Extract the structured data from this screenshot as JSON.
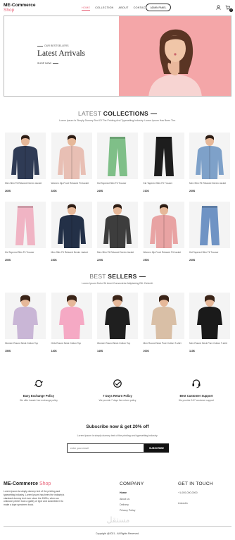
{
  "header": {
    "logo_line1": "ME-Commerce",
    "logo_line2": "Shop",
    "nav": [
      "HOME",
      "COLLECTION",
      "ABOUT",
      "CONTACT"
    ],
    "admin_label": "ADMIN PANEL",
    "icons": [
      "user-icon",
      "cart-icon"
    ],
    "cart_count": "0"
  },
  "hero": {
    "kicker": "OUR BESTSELLERS",
    "title": "Latest Arrivals",
    "cta": "SHOP NOW",
    "bg_color": "#f4a6a8"
  },
  "collections": {
    "title_a": "LATEST",
    "title_b": "COLLECTIONS",
    "subtitle": "Lorem Ipsum Is Simply Dummy Text Of The Printing And Typesetting Industry. Lorem Ipsum Has Been The.",
    "products": [
      {
        "name": "Men Slim Fit Relaxed Denim Jacket",
        "price": "260$",
        "kind": "jacket",
        "color": "#2f3b55"
      },
      {
        "name": "Women Zip-Front Relaxed Fit Jacket",
        "price": "320$",
        "kind": "jacket",
        "color": "#e8bfb4"
      },
      {
        "name": "Kid Tapered Slim Fit Trouser",
        "price": "240$",
        "kind": "pants",
        "color": "#7fbf88"
      },
      {
        "name": "Kid Tapered Slim Fit Trouser",
        "price": "210$",
        "kind": "pants",
        "color": "#1d1d1d"
      },
      {
        "name": "Men Slim Fit Relaxed Denim Jacket",
        "price": "260$",
        "kind": "jacket",
        "color": "#7ea1c9"
      },
      {
        "name": "Kid Tapered Slim Fit Trouser",
        "price": "200$",
        "kind": "pants",
        "color": "#f0b4c4"
      },
      {
        "name": "Men Slim Fit Relaxed Denim Jacket",
        "price": "230$",
        "kind": "jacket",
        "color": "#233047"
      },
      {
        "name": "Men Slim Fit Relaxed Denim Jacket",
        "price": "220$",
        "kind": "jacket",
        "color": "#3d3d3d"
      },
      {
        "name": "Women Zip-Front Relaxed Fit Jacket",
        "price": "250$",
        "kind": "jacket",
        "color": "#e8a3a3"
      },
      {
        "name": "Kid Tapered Slim Fit Trouser",
        "price": "260$",
        "kind": "pants",
        "color": "#6f93c4"
      }
    ]
  },
  "bestsellers": {
    "title_a": "BEST",
    "title_b": "SELLERS",
    "subtitle": "Lorem Ipsum Dolor Sit Amet Consectetur Adipisicing Elit. Deleniti.",
    "products": [
      {
        "name": "Women Round Neck Cotton Top",
        "price": "150$",
        "kind": "top",
        "color": "#c9b6d6"
      },
      {
        "name": "Girls Round Neck Cotton Top",
        "price": "140$",
        "kind": "top",
        "color": "#f5a9c4"
      },
      {
        "name": "Women Round Neck Cotton Top",
        "price": "140$",
        "kind": "top",
        "color": "#1f1f1f"
      },
      {
        "name": "Men Round Neck Pure Cotton T-shirt",
        "price": "200$",
        "kind": "top",
        "color": "#d9bfa6"
      },
      {
        "name": "Men Round Neck Pure Cotton T-shirt",
        "price": "110$",
        "kind": "top",
        "color": "#1a1a1a"
      }
    ]
  },
  "policies": [
    {
      "title": "Easy Exchange Policy",
      "desc": "We offer hassle free exchange policy",
      "icon": "exchange-icon"
    },
    {
      "title": "7 Days Return Policy",
      "desc": "We provide 7 days free return policy",
      "icon": "return-icon"
    },
    {
      "title": "Best Customer Support",
      "desc": "We provide 24/7 customer support",
      "icon": "headset-icon"
    }
  ],
  "subscribe": {
    "title": "Subscribe now & get 20% off",
    "desc": "Lorem Ipsum is simply dummy text of the printing and typesetting industry.",
    "placeholder": "enter your email",
    "button": "SUBSCRIBE"
  },
  "footer": {
    "logo_a": "ME-Commerce",
    "logo_b": "Shop",
    "about": "Lorem Ipsum is simply dummy text of the printing and typesetting industry. Lorem Ipsum has been the industry's standard dummy text ever since the 1500s, when an unknown printer took a galley of type and scrambled it to make a type specimen book.",
    "company_title": "COMPANY",
    "company_links": [
      "Home",
      "About us",
      "Delivery",
      "Privacy Policy"
    ],
    "contact_title": "GET IN TOUCH",
    "phone": "+1-000-000-0000",
    "linkedin": "LinkedIn",
    "copyright": "Copyright @2021 - All Rights Reserved.",
    "watermark": "مستقل"
  }
}
